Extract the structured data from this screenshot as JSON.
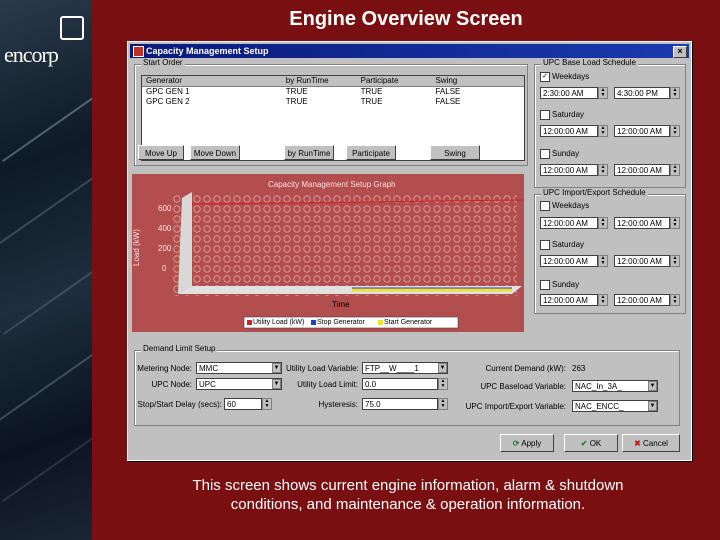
{
  "slide": {
    "title": "Engine Overview Screen",
    "caption_line1": "This screen shows current engine information, alarm & shutdown",
    "caption_line2": "conditions, and maintenance & operation information.",
    "logo_text": "encorp"
  },
  "window": {
    "title": "Capacity Management Setup",
    "close_glyph": "×"
  },
  "start_order": {
    "label": "Start Order",
    "columns": [
      "Generator",
      "by RunTime",
      "Participate",
      "Swing"
    ],
    "rows": [
      [
        "GPC GEN 1",
        "TRUE",
        "TRUE",
        "FALSE"
      ],
      [
        "GPC GEN 2",
        "TRUE",
        "TRUE",
        "FALSE"
      ]
    ],
    "buttons": {
      "move_up": "Move Up",
      "move_down": "Move Down",
      "by_runtime": "by RunTime",
      "participate": "Participate",
      "swing": "Swing"
    }
  },
  "graph": {
    "title": "Capacity Management Setup Graph",
    "ylabel": "Load (kW)",
    "xlabel": "Time",
    "ticks": [
      "600",
      "400",
      "200",
      "0"
    ],
    "legend": [
      "Utility Load (kW)",
      "Stop Generator",
      "Start Generator"
    ]
  },
  "baseload_schedule": {
    "label": "UPC Base Load Schedule",
    "weekdays_label": "Weekdays",
    "weekdays_checked": true,
    "weekdays_start": "2:30:00 AM",
    "weekdays_end": "4:30:00 PM",
    "saturday_label": "Saturday",
    "saturday_start": "12:00:00 AM",
    "saturday_end": "12:00:00 AM",
    "sunday_label": "Sunday",
    "sunday_start": "12:00:00 AM",
    "sunday_end": "12:00:00 AM"
  },
  "import_export_schedule": {
    "label": "UPC Import/Export Schedule",
    "weekdays_label": "Weekdays",
    "weekdays_start": "12:00:00 AM",
    "weekdays_end": "12:00:00 AM",
    "saturday_label": "Saturday",
    "saturday_start": "12:00:00 AM",
    "saturday_end": "12:00:00 AM",
    "sunday_label": "Sunday",
    "sunday_start": "12:00:00 AM",
    "sunday_end": "12:00:00 AM"
  },
  "demand_limit": {
    "label": "Demand Limit Setup",
    "metering_node_label": "Metering Node:",
    "metering_node_value": "MMC",
    "upc_node_label": "UPC Node:",
    "upc_node_value": "UPC",
    "stop_start_delay_label": "Stop/Start Delay (secs):",
    "stop_start_delay_value": "60",
    "utility_load_variable_label": "Utility Load Variable:",
    "utility_load_variable_value": "FTP__W____1",
    "utility_load_limit_label": "Utility Load Limit:",
    "utility_load_limit_value": "0.0",
    "hysteresis_label": "Hysteresis:",
    "hysteresis_value": "75.0",
    "current_demand_label": "Current Demand (kW):",
    "current_demand_value": "263",
    "upc_baseload_variable_label": "UPC Baseload Variable:",
    "upc_baseload_variable_value": "NAC_In_3A_",
    "upc_import_export_variable_label": "UPC Import/Export Variable:",
    "upc_import_export_variable_value": "NAC_ENCC_"
  },
  "footer_buttons": {
    "apply": "Apply",
    "ok": "OK",
    "cancel": "Cancel"
  },
  "colors": {
    "slide_bg": "#7a0f12",
    "titlebar": "#0a1a7a",
    "utility_load": "#d02020",
    "stop_generator": "#2040c0",
    "start_generator": "#f0e030"
  }
}
